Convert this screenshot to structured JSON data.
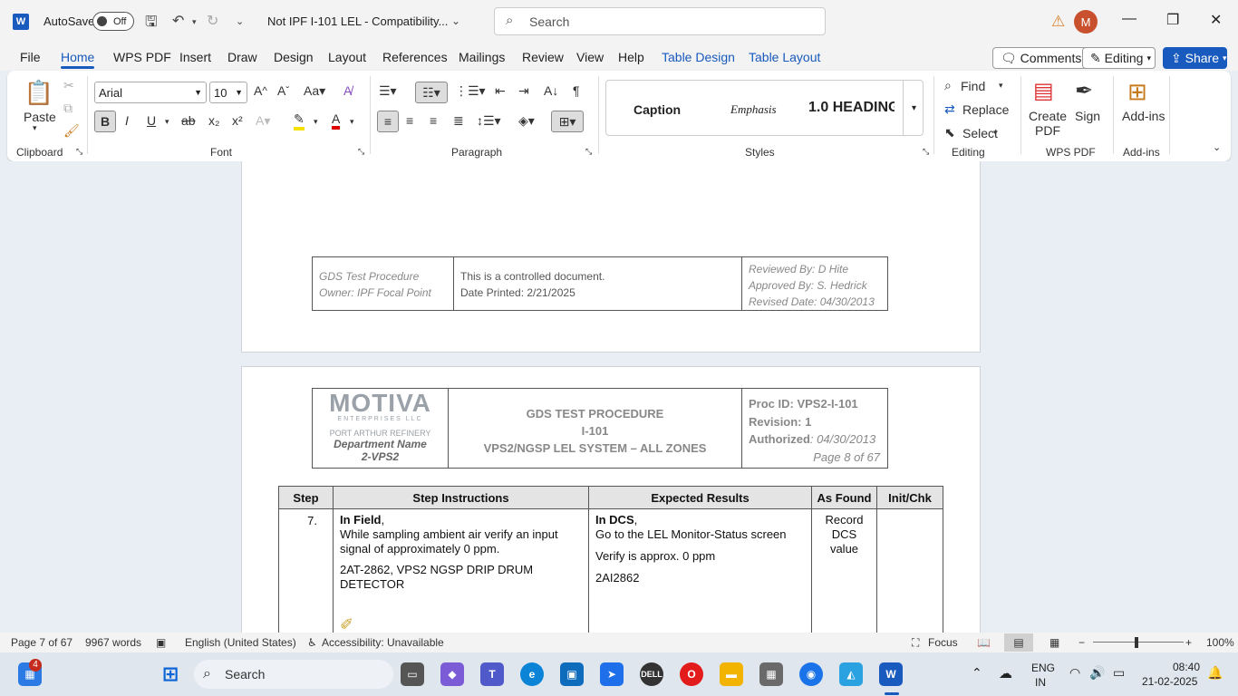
{
  "titlebar": {
    "autosave": "AutoSave",
    "toggle": "Off",
    "doc_title": "Not IPF I-101 LEL  -  Compatibility...",
    "search_placeholder": "Search",
    "avatar": "M"
  },
  "tabs": [
    "File",
    "Home",
    "WPS PDF",
    "Insert",
    "Draw",
    "Design",
    "Layout",
    "References",
    "Mailings",
    "Review",
    "View",
    "Help",
    "Table Design",
    "Table Layout"
  ],
  "buttons": {
    "comments": "Comments",
    "editing": "Editing",
    "share": "Share"
  },
  "ribbon": {
    "paste": "Paste",
    "font_name": "Arial",
    "font_size": "10",
    "styles": {
      "caption": "Caption",
      "emphasis": "Emphasis",
      "heading": "1.0  HEADING"
    },
    "find": "Find",
    "replace": "Replace",
    "select": "Select",
    "create_pdf": "Create PDF",
    "sign": "Sign",
    "addins": "Add-ins",
    "groups": {
      "clipboard": "Clipboard",
      "font": "Font",
      "paragraph": "Paragraph",
      "styles": "Styles",
      "editing": "Editing",
      "wps": "WPS PDF",
      "addins": "Add-ins"
    }
  },
  "footer_prev": {
    "col1": [
      "GDS Test Procedure",
      "Owner: IPF Focal Point"
    ],
    "col2": [
      "This is a controlled document.",
      "Date Printed: 2/21/2025"
    ],
    "col3": [
      "Reviewed By: D Hite",
      "Approved By: S. Hedrick",
      "Revised Date: 04/30/2013"
    ]
  },
  "header": {
    "logo": "MOTIVA",
    "logo_sub": "ENTERPRISES LLC",
    "refinery": "PORT ARTHUR REFINERY",
    "dept": "Department Name",
    "dept_val": "2-VPS2",
    "title1": "GDS TEST PROCEDURE",
    "title2": "I-101",
    "title3": "VPS2/NGSP LEL SYSTEM – ALL ZONES",
    "proc": "Proc ID: VPS2-I-101",
    "rev": "Revision: 1",
    "auth_label": "Authorized",
    "auth_val": ": 04/30/2013",
    "page": "Page 8 of 67"
  },
  "table": {
    "headers": [
      "Step",
      "Step Instructions",
      "Expected Results",
      "As Found",
      "Init/Chk"
    ],
    "row": {
      "step": "7.",
      "instr_bold": "In Field",
      "instr_rest": ",",
      "instr1": "While sampling ambient air verify an input signal of approximately 0 ppm.",
      "instr2": "2AT-2862, VPS2 NGSP DRIP DRUM DETECTOR",
      "exp_bold": "In DCS",
      "exp_rest": ",",
      "exp1": "Go to the LEL Monitor-Status screen",
      "exp2": "Verify is approx. 0 ppm",
      "exp3": "2AI2862",
      "asfound": "Record DCS value"
    }
  },
  "status": {
    "page": "Page 7 of 67",
    "words": "9967 words",
    "lang": "English (United States)",
    "access": "Accessibility: Unavailable",
    "focus": "Focus",
    "zoom": "100%"
  },
  "taskbar": {
    "search": "Search",
    "badge": "4",
    "lang1": "ENG",
    "lang2": "IN",
    "time": "08:40",
    "date": "21-02-2025"
  }
}
